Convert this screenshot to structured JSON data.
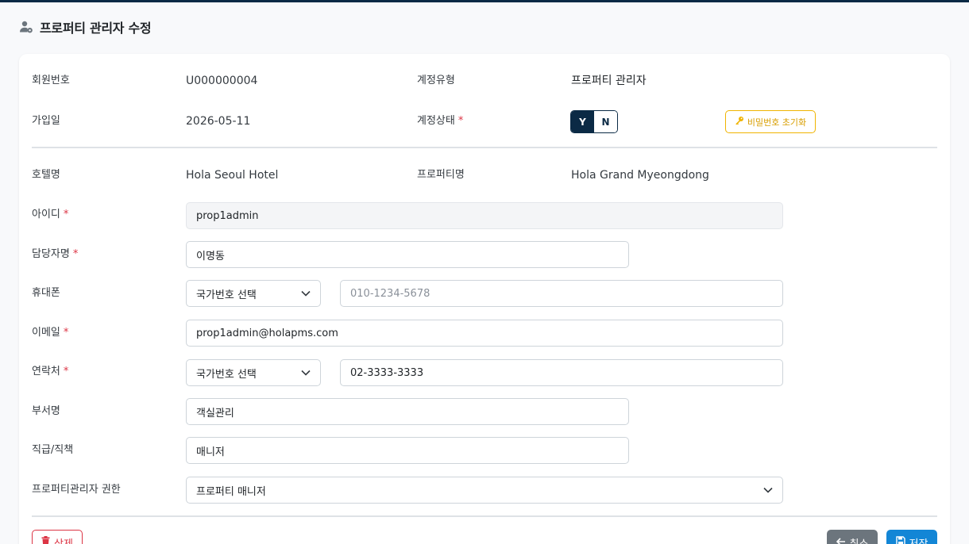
{
  "header": {
    "title": "프로퍼티 관리자 수정",
    "icon": "user-gear-icon"
  },
  "info": {
    "member_no_label": "회원번호",
    "member_no": "U000000004",
    "account_type_label": "계정유형",
    "account_type": "프로퍼티 관리자",
    "join_date_label": "가입일",
    "join_date": "2026-05-11",
    "account_status_label": "계정상태",
    "status_yes": "Y",
    "status_no": "N",
    "status_selected": "Y",
    "reset_password_label": "비밀번호 초기화"
  },
  "form": {
    "hotel_label": "호텔명",
    "hotel_value": "Hola Seoul Hotel",
    "property_label": "프로퍼티명",
    "property_value": "Hola Grand Myeongdong",
    "id_label": "아이디",
    "id_value": "prop1admin",
    "manager_name_label": "담당자명",
    "manager_name_value": "이명동",
    "mobile_label": "휴대폰",
    "mobile_country": "국가번호 선택",
    "mobile_placeholder": "010-1234-5678",
    "email_label": "이메일",
    "email_value": "prop1admin@holapms.com",
    "contact_label": "연락처",
    "contact_country": "국가번호 선택",
    "contact_value": "02-3333-3333",
    "department_label": "부서명",
    "department_value": "객실관리",
    "position_label": "직급/직책",
    "position_value": "매니저",
    "role_label": "프로퍼티관리자 권한",
    "role_value": "프로퍼티 매니저"
  },
  "actions": {
    "delete_label": "삭제",
    "cancel_label": "취소",
    "save_label": "저장"
  },
  "colors": {
    "primary": "#0b2a45",
    "save": "#1386d6",
    "danger": "#dc3545",
    "warning": "#f0b400",
    "cancel": "#6c757d"
  }
}
